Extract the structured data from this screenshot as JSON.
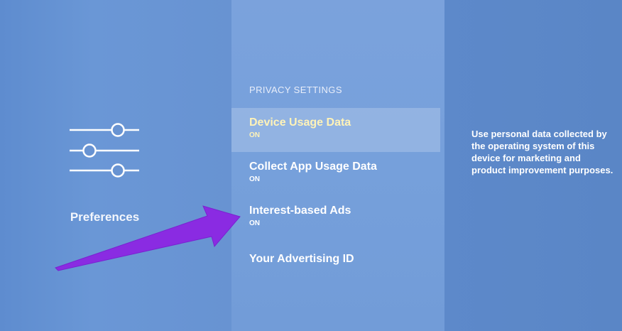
{
  "left_pane": {
    "title": "Preferences",
    "icon": "sliders-icon"
  },
  "menu": {
    "section_header": "PRIVACY SETTINGS",
    "items": [
      {
        "label": "Device Usage Data",
        "status": "ON",
        "selected": true
      },
      {
        "label": "Collect App Usage Data",
        "status": "ON",
        "selected": false
      },
      {
        "label": "Interest-based Ads",
        "status": "ON",
        "selected": false
      },
      {
        "label": "Your Advertising ID",
        "status": "",
        "selected": false
      }
    ]
  },
  "description": "Use personal data collected by the operating system of this device for marketing and product improvement purposes.",
  "colors": {
    "accent_selected": "#fff3b8",
    "arrow": "#8a2be2"
  }
}
